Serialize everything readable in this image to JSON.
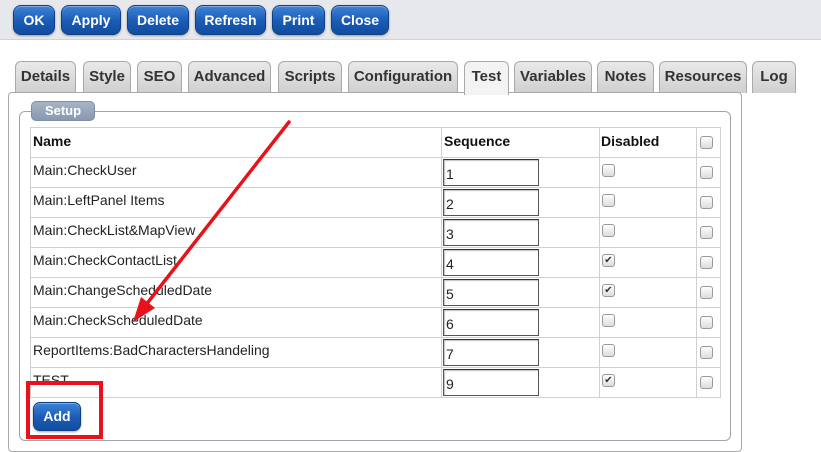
{
  "toolbar": {
    "buttons": [
      "OK",
      "Apply",
      "Delete",
      "Refresh",
      "Print",
      "Close"
    ]
  },
  "tabs": {
    "labels": [
      "Details",
      "Style",
      "SEO",
      "Advanced",
      "Scripts",
      "Configuration",
      "Test",
      "Variables",
      "Notes",
      "Resources",
      "Log"
    ],
    "active": "Test"
  },
  "setup": {
    "legend": "Setup",
    "headers": {
      "name": "Name",
      "sequence": "Sequence",
      "disabled": "Disabled"
    },
    "header_select_all_checked": false,
    "rows": [
      {
        "name": "Main:CheckUser",
        "sequence": "1",
        "disabled": false,
        "selected": false
      },
      {
        "name": "Main:LeftPanel Items",
        "sequence": "2",
        "disabled": false,
        "selected": false
      },
      {
        "name": "Main:CheckList&MapView",
        "sequence": "3",
        "disabled": false,
        "selected": false
      },
      {
        "name": "Main:CheckContactList",
        "sequence": "4",
        "disabled": true,
        "selected": false
      },
      {
        "name": "Main:ChangeScheduledDate",
        "sequence": "5",
        "disabled": true,
        "selected": false
      },
      {
        "name": "Main:CheckScheduledDate",
        "sequence": "6",
        "disabled": false,
        "selected": false
      },
      {
        "name": "ReportItems:BadCharactersHandeling",
        "sequence": "7",
        "disabled": false,
        "selected": false
      },
      {
        "name": "TEST",
        "sequence": "9",
        "disabled": true,
        "selected": false
      }
    ],
    "add_label": "Add"
  },
  "colors": {
    "button_blue": "#1a5bb5",
    "annotation_red": "#e8121b",
    "legend_gray": "#8799b1"
  }
}
